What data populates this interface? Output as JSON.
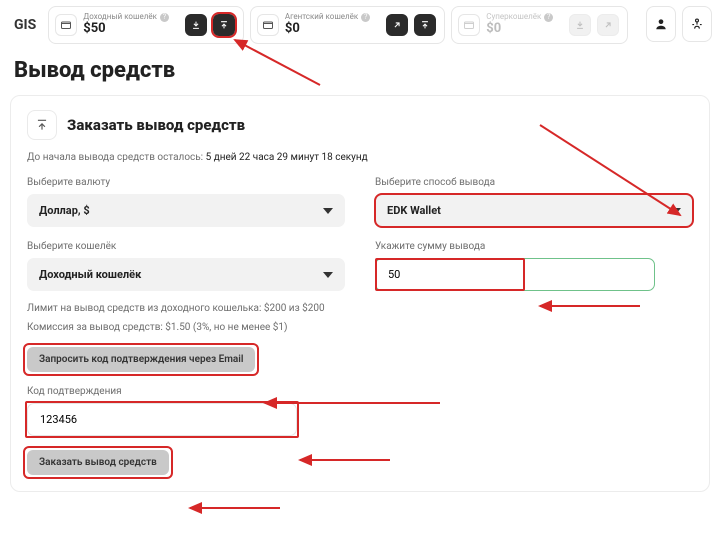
{
  "brand": "GIS",
  "wallets": [
    {
      "label": "Доходный кошелёк",
      "amount": "$50"
    },
    {
      "label": "Агентский кошелёк",
      "amount": "$0"
    },
    {
      "label": "Суперкошелёк",
      "amount": "$0"
    }
  ],
  "page_title": "Вывод средств",
  "section_title": "Заказать вывод средств",
  "countdown_label": "До начала вывода средств осталось:",
  "countdown_value": "5 дней 22 часа 29 минут 18 секунд",
  "fields": {
    "currency_label": "Выберите валюту",
    "currency_value": "Доллар, $",
    "method_label": "Выберите способ вывода",
    "method_value": "EDK Wallet",
    "wallet_label": "Выберите кошелёк",
    "wallet_value": "Доходный кошелёк",
    "amount_label": "Укажите сумму вывода",
    "amount_value": "50"
  },
  "limit_line": "Лимит на вывод средств из доходного кошелька: $200 из $200",
  "fee_line": "Комиссия за вывод средств: $1.50 (3%, но не менее $1)",
  "email_btn": "Запросить код подтверждения через Email",
  "code_label": "Код подтверждения",
  "code_value": "123456",
  "submit_btn": "Заказать вывод средств"
}
